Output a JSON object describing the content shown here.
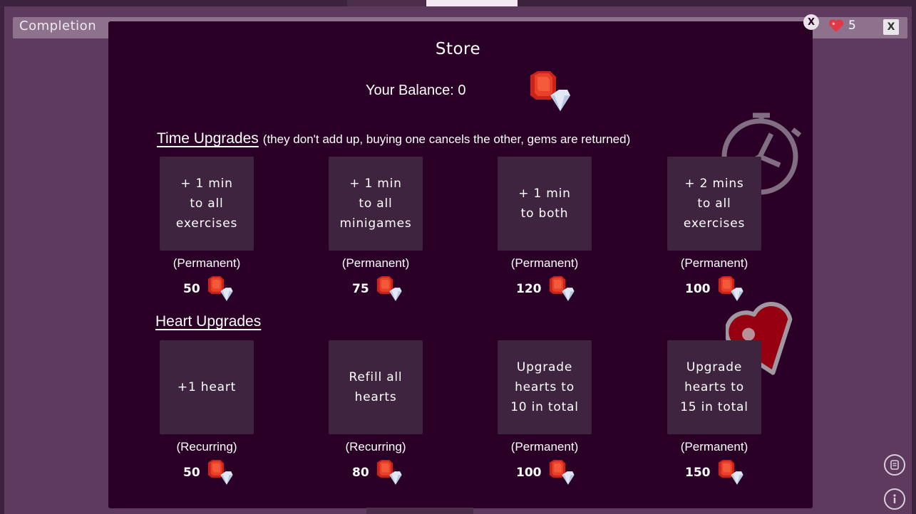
{
  "header": {
    "completion_label": "Completion",
    "hearts_count": "5",
    "close_label": "X"
  },
  "store": {
    "close_label": "X",
    "title": "Store",
    "balance_text": "Your Balance: 0"
  },
  "time_upgrades": {
    "title": "Time Upgrades",
    "note": "(they don't add up, buying one cancels the other, gems are returned)",
    "items": [
      {
        "label": "+ 1 min\nto all\nexercises",
        "type": "(Permanent)",
        "price": "50"
      },
      {
        "label": "+ 1 min\nto all\nminigames",
        "type": "(Permanent)",
        "price": "75"
      },
      {
        "label": "+ 1 min\nto both",
        "type": "(Permanent)",
        "price": "120"
      },
      {
        "label": "+ 2 mins\nto all\nexercises",
        "type": "(Permanent)",
        "price": "100"
      }
    ]
  },
  "heart_upgrades": {
    "title": "Heart Upgrades",
    "items": [
      {
        "label": "+1 heart",
        "type": "(Recurring)",
        "price": "50"
      },
      {
        "label": "Refill all\nhearts",
        "type": "(Recurring)",
        "price": "80"
      },
      {
        "label": "Upgrade\nhearts to\n10 in total",
        "type": "(Permanent)",
        "price": "100"
      },
      {
        "label": "Upgrade\nhearts to\n15 in total",
        "type": "(Permanent)",
        "price": "150"
      }
    ]
  },
  "icons": {
    "gem": "gem-icon",
    "stopwatch": "stopwatch-icon",
    "heart": "heart-icon",
    "scroll": "scroll-icon",
    "info": "info-icon"
  },
  "colors": {
    "panel": "#2a0027",
    "card": "#3f2440",
    "ruby": "#d8321f",
    "heart": "#9c0010"
  }
}
